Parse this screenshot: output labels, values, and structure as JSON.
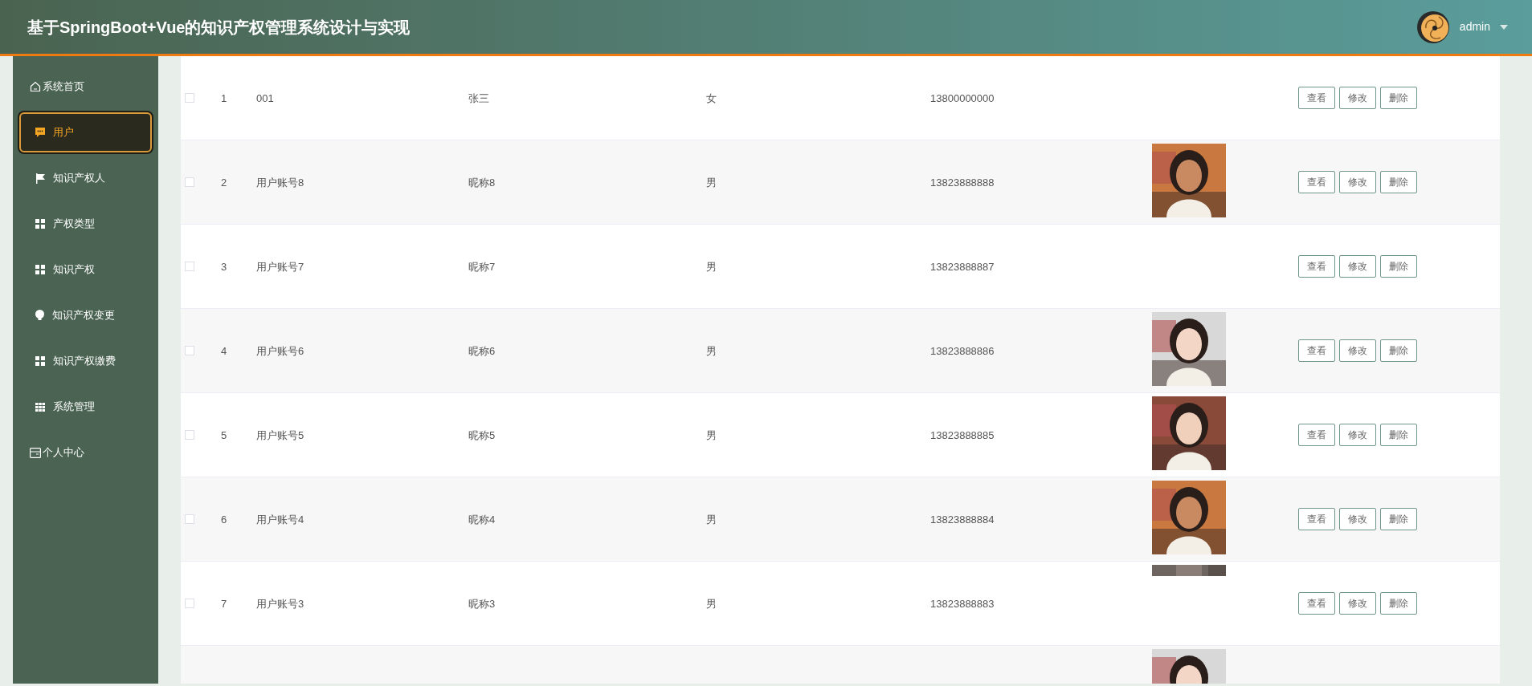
{
  "header": {
    "title": "基于SpringBoot+Vue的知识产权管理系统设计与实现",
    "user": "admin"
  },
  "sidebar": {
    "items": [
      {
        "label": "系统首页",
        "selected": false,
        "kind": "plain"
      },
      {
        "label": "用户",
        "selected": true,
        "kind": "menu"
      },
      {
        "label": "知识产权人",
        "selected": false,
        "kind": "menu"
      },
      {
        "label": "产权类型",
        "selected": false,
        "kind": "menu"
      },
      {
        "label": "知识产权",
        "selected": false,
        "kind": "menu"
      },
      {
        "label": "知识产权变更",
        "selected": false,
        "kind": "menu"
      },
      {
        "label": "知识产权缴费",
        "selected": false,
        "kind": "menu"
      },
      {
        "label": "系统管理",
        "selected": false,
        "kind": "menu"
      },
      {
        "label": "个人中心",
        "selected": false,
        "kind": "plain"
      }
    ]
  },
  "table": {
    "rows": [
      {
        "index": "1",
        "account": "001",
        "nickname": "张三",
        "gender": "女",
        "phone": "13800000000",
        "checked": false,
        "actions": [
          "查看",
          "修改",
          "删除"
        ]
      },
      {
        "index": "2",
        "account": "用户账号8",
        "nickname": "昵称8",
        "gender": "男",
        "phone": "13823888888",
        "checked": false,
        "photo": {
          "kind": "picture"
        },
        "actions": [
          "查看",
          "修改",
          "删除"
        ]
      },
      {
        "index": "3",
        "account": "用户账号7",
        "nickname": "昵称7",
        "gender": "男",
        "phone": "13823888887",
        "checked": false,
        "actions": [
          "查看",
          "修改",
          "删除"
        ]
      },
      {
        "index": "4",
        "account": "用户账号6",
        "nickname": "昵称6",
        "gender": "男",
        "phone": "13823888886",
        "checked": false,
        "photo": {
          "kind": "picture"
        },
        "actions": [
          "查看",
          "修改",
          "删除"
        ]
      },
      {
        "index": "5",
        "account": "用户账号5",
        "nickname": "昵称5",
        "gender": "男",
        "phone": "13823888885",
        "checked": false,
        "photo": {
          "kind": "picture"
        },
        "actions": [
          "查看",
          "修改",
          "删除"
        ]
      },
      {
        "index": "6",
        "account": "用户账号4",
        "nickname": "昵称4",
        "gender": "男",
        "phone": "13823888884",
        "checked": false,
        "photo": {
          "kind": "picture"
        },
        "actions": [
          "查看",
          "修改",
          "删除"
        ]
      },
      {
        "index": "7",
        "account": "用户账号3",
        "nickname": "昵称3",
        "gender": "男",
        "phone": "13823888883",
        "checked": false,
        "photo": {
          "kind": "strip"
        },
        "actions": [
          "查看",
          "修改",
          "删除"
        ]
      },
      {
        "photo": {
          "kind": "picture"
        }
      }
    ]
  }
}
